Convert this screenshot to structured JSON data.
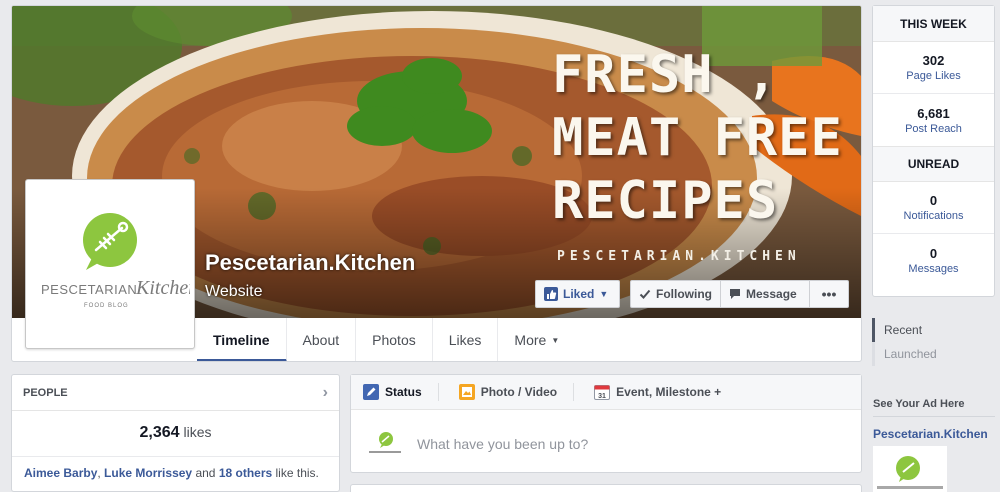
{
  "cover": {
    "slogan": [
      "FRESH ,",
      "MEAT FREE",
      "RECIPES"
    ],
    "handle": "PESCETARIAN.KITCHEN"
  },
  "page": {
    "name": "Pescetarian.Kitchen",
    "category": "Website",
    "logo": {
      "wordmark_left": "PESCETARIAN",
      "wordmark_right": "Kitchen",
      "tagline": "FOOD BLOG"
    }
  },
  "actions": {
    "liked": "Liked",
    "following": "Following",
    "message": "Message",
    "more": "•••"
  },
  "tabs": [
    "Timeline",
    "About",
    "Photos",
    "Likes",
    "More"
  ],
  "this_week": {
    "header": "THIS WEEK",
    "page_likes": {
      "value": "302",
      "label": "Page Likes"
    },
    "post_reach": {
      "value": "6,681",
      "label": "Post Reach"
    }
  },
  "unread": {
    "header": "UNREAD",
    "notifications": {
      "value": "0",
      "label": "Notifications"
    },
    "messages": {
      "value": "0",
      "label": "Messages"
    }
  },
  "timeline_years": [
    "Recent",
    "Launched"
  ],
  "ad": {
    "header": "See Your Ad Here",
    "page_name": "Pescetarian.Kitchen"
  },
  "people": {
    "header": "PEOPLE",
    "likes_count": "2,364",
    "likes_word": "likes",
    "friend1": "Aimee Barby",
    "friend2": "Luke Morrissey",
    "and_word": "and",
    "others": "18 others",
    "suffix": "like this."
  },
  "composer": {
    "tab_status": "Status",
    "tab_photo": "Photo / Video",
    "tab_event": "Event, Milestone +",
    "calendar_day": "31",
    "placeholder": "What have you been up to?"
  },
  "colors": {
    "fb_blue": "#3b5998",
    "logo_green": "#8dc63f",
    "background": "#e9eaed"
  }
}
